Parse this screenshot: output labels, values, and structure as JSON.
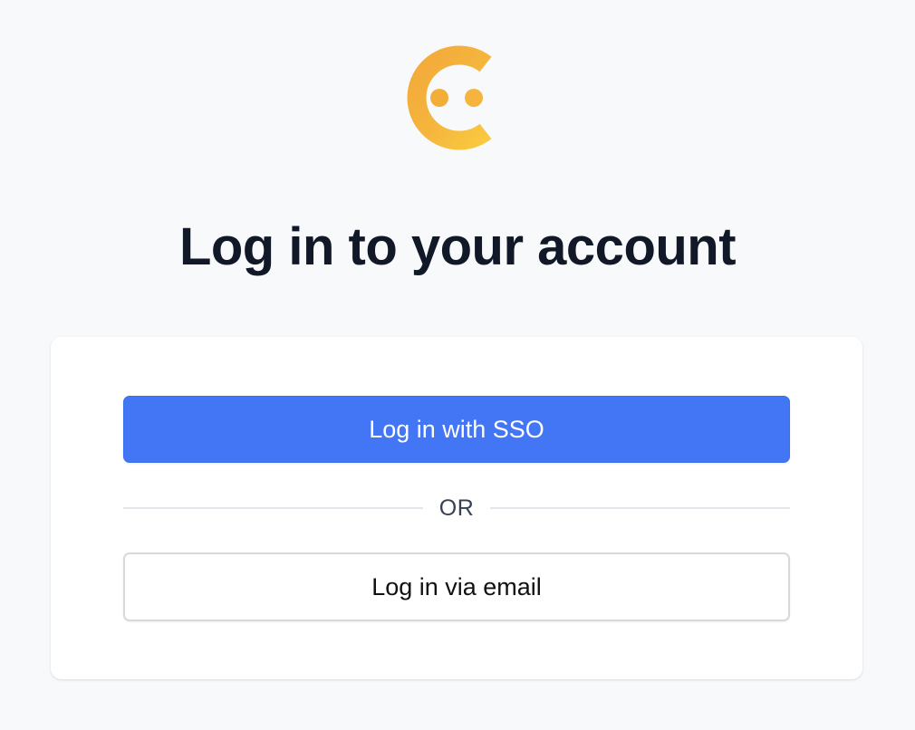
{
  "logo": {
    "icon": "smiley-c-logo-icon",
    "color_primary": "#f4ad36",
    "color_secondary": "#f8c73f"
  },
  "header": {
    "title": "Log in to your account"
  },
  "login_card": {
    "sso_button_label": "Log in with SSO",
    "divider_label": "OR",
    "email_button_label": "Log in via email"
  },
  "colors": {
    "background": "#f8f9fb",
    "accent": "#4276f5",
    "title_text": "#111827"
  }
}
